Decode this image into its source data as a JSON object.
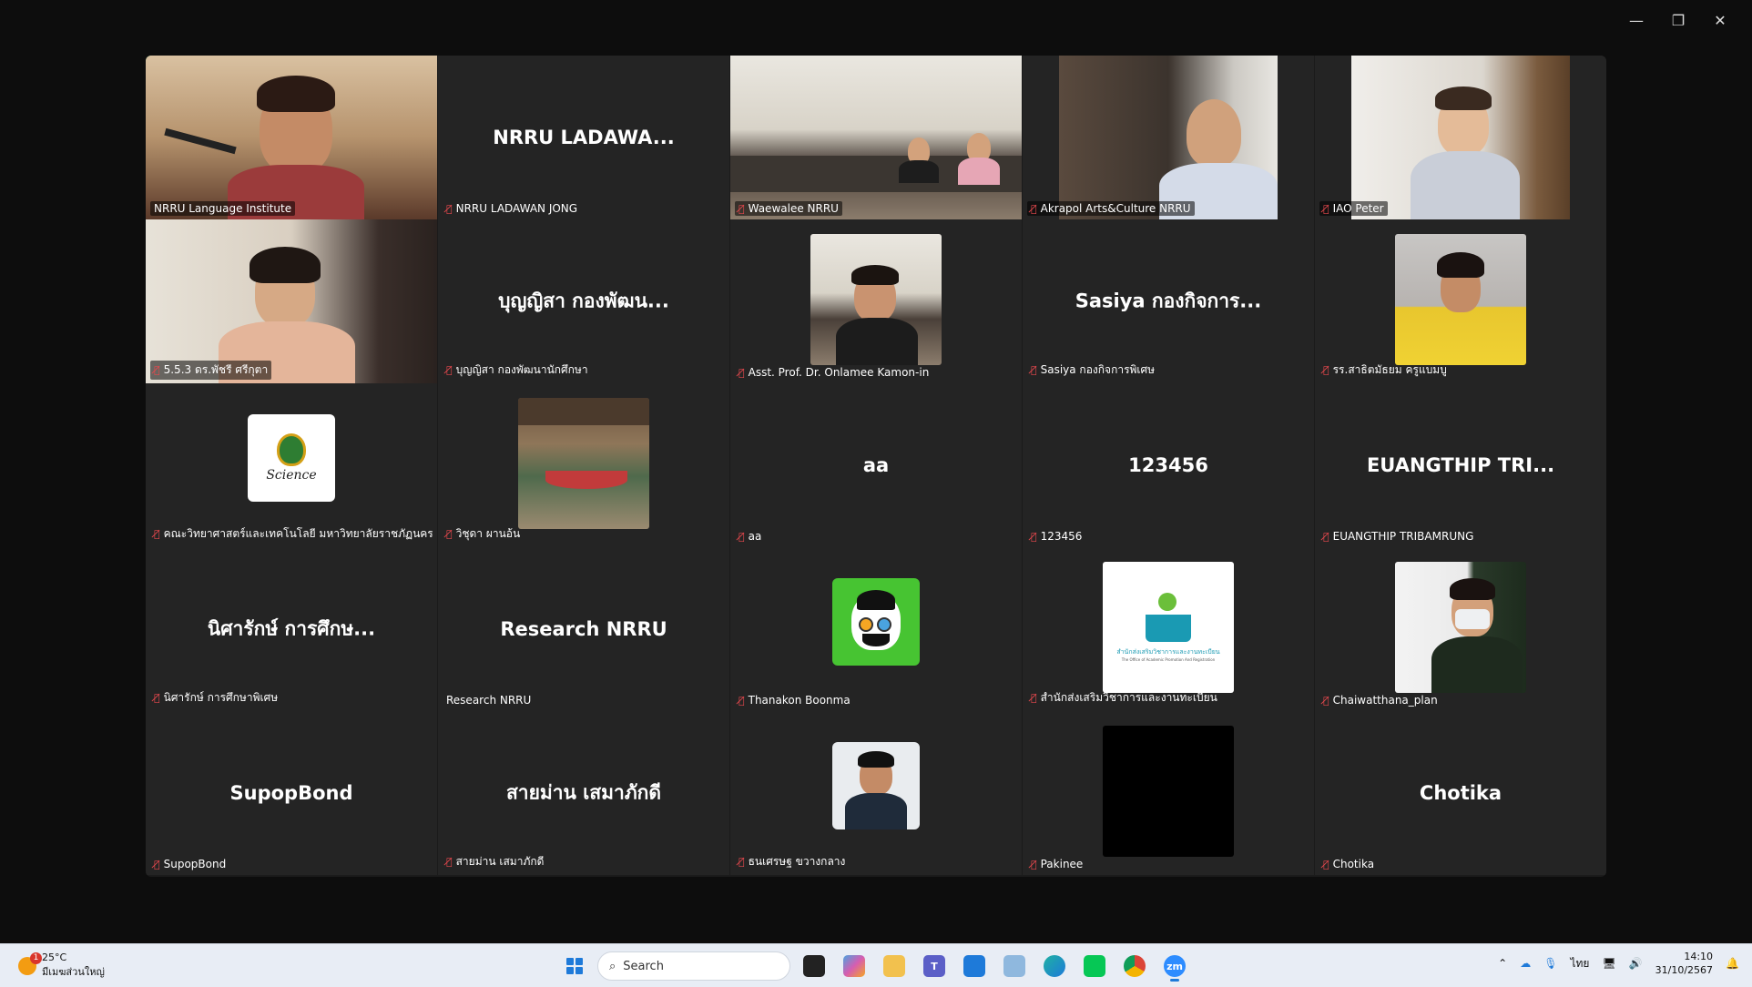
{
  "window": {
    "minimize": "—",
    "restore": "❐",
    "close": "✕"
  },
  "tiles": [
    {
      "label": "NRRU Language Institute",
      "muted": false,
      "active": true
    },
    {
      "center": "NRRU  LADAWA...",
      "label": "NRRU LADAWAN JONG",
      "muted": true
    },
    {
      "label": "Waewalee NRRU",
      "muted": true
    },
    {
      "label": "Akrapol Arts&Culture NRRU",
      "muted": true
    },
    {
      "label": "IAO Peter",
      "muted": true
    },
    {
      "label": "5.5.3 ดร.พัชรี ศรีกุตา",
      "muted": true
    },
    {
      "center": "บุญญิสา กองพัฒน...",
      "label": "บุญญิสา กองพัฒนานักศึกษา",
      "muted": true
    },
    {
      "label": "Asst. Prof. Dr. Onlamee Kamon-in",
      "muted": true
    },
    {
      "center": "Sasiya กองกิจการ...",
      "label": "Sasiya กองกิจการพิเศษ",
      "muted": true
    },
    {
      "label": "รร.สาธิตมัธยม ครูแบมบู",
      "muted": true
    },
    {
      "label": "คณะวิทยาศาสตร์และเทคโนโลยี มหาวิทยาลัยราชภัฏนครรา...",
      "muted": true,
      "logo_text": "Science"
    },
    {
      "label": "วิชุดา ผานอ้น",
      "muted": true
    },
    {
      "center": "aa",
      "label": "aa",
      "muted": true
    },
    {
      "center": "123456",
      "label": "123456",
      "muted": true
    },
    {
      "center": "EUANGTHIP TRI...",
      "label": "EUANGTHIP TRIBAMRUNG",
      "muted": true
    },
    {
      "center": "นิศารักษ์ การศึกษ...",
      "label": "นิศารักษ์ การศึกษาพิเศษ",
      "muted": true
    },
    {
      "center": "Research NRRU",
      "label": "Research NRRU",
      "muted": false
    },
    {
      "label": "Thanakon Boonma",
      "muted": true
    },
    {
      "label": "สำนักส่งเสริมวิชาการและงานทะเบียน",
      "muted": true,
      "logo_text": "สำนักส่งเสริมวิชาการและงานทะเบียน",
      "logo_sub": "The Office of Academic Promotion And Registration"
    },
    {
      "label": "Chaiwatthana_plan",
      "muted": true
    },
    {
      "center": "SupopBond",
      "label": "SupopBond",
      "muted": true
    },
    {
      "center": "สายม่าน เสมาภักดี",
      "label": "สายม่าน เสมาภักดี",
      "muted": true
    },
    {
      "label": "ธนเศรษฐ ขวางกลาง",
      "muted": true
    },
    {
      "label": "Pakinee",
      "muted": true
    },
    {
      "center": "Chotika",
      "label": "Chotika",
      "muted": true
    }
  ],
  "taskbar": {
    "weather_temp": "25°C",
    "weather_desc": "มีเมฆส่วนใหญ่",
    "weather_badge": "1",
    "search_placeholder": "Search",
    "lang": "ไทย",
    "time": "14:10",
    "date": "31/10/2567",
    "zoom_label": "zm"
  },
  "colors": {
    "active_border": "#3ddc84",
    "muted": "#e5484d",
    "accent": "#1e7ad9"
  }
}
